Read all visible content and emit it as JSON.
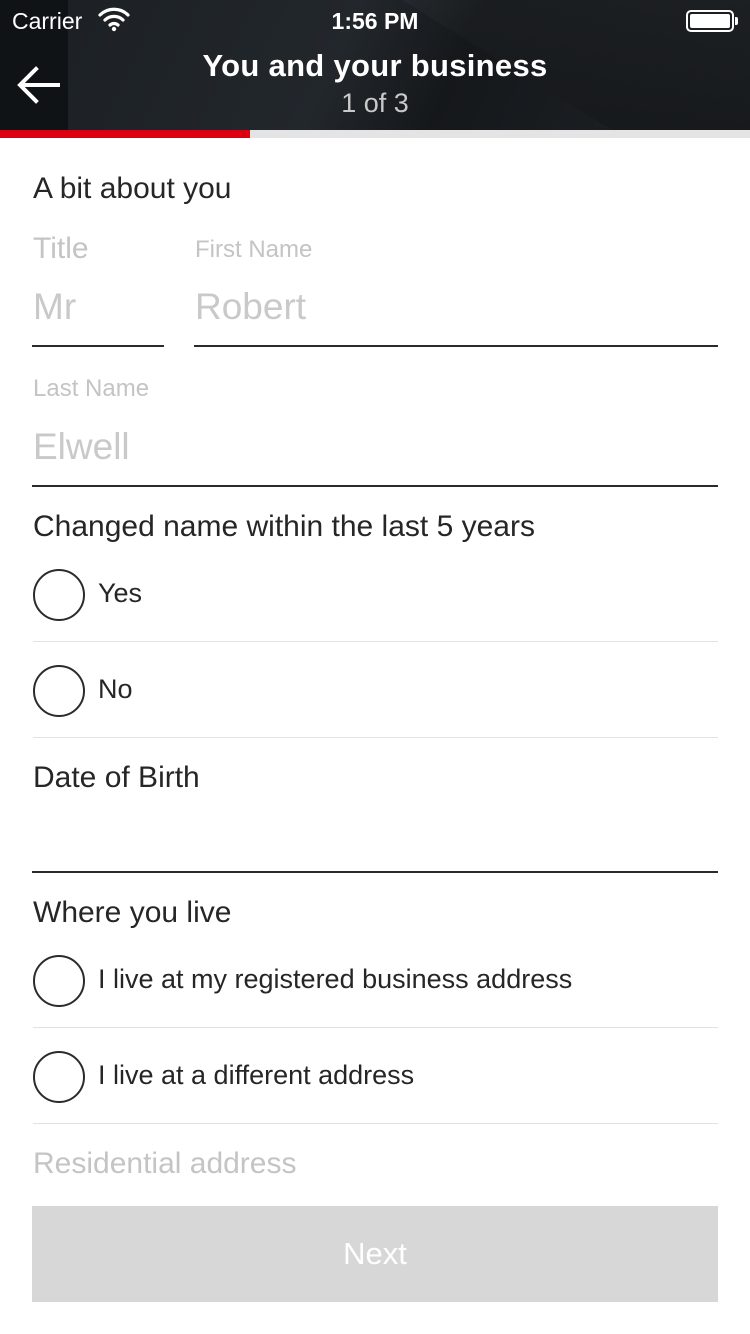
{
  "status_bar": {
    "carrier": "Carrier",
    "time": "1:56 PM"
  },
  "header": {
    "title": "You and your business",
    "subtitle": "1 of 3",
    "progress_fraction": 0.3333
  },
  "colors": {
    "accent": "#db0011",
    "header_bg": "#1b1f23",
    "button_disabled": "#d7d7d7",
    "placeholder": "#c4c4c4"
  },
  "form": {
    "section_about": "A bit about you",
    "title_field": {
      "label": "Title",
      "value": "Mr"
    },
    "first_name_field": {
      "label": "First Name",
      "value": "Robert"
    },
    "last_name_field": {
      "label": "Last Name",
      "value": "Elwell"
    },
    "changed_name": {
      "question": "Changed name within the last 5 years",
      "options": [
        "Yes",
        "No"
      ]
    },
    "dob": {
      "label": "Date of Birth",
      "value": ""
    },
    "where_you_live": {
      "heading": "Where you live",
      "options": [
        "I live at my registered business address",
        "I live at a different address"
      ]
    },
    "residential_address": {
      "label": "Residential address"
    }
  },
  "next_button": {
    "label": "Next"
  }
}
